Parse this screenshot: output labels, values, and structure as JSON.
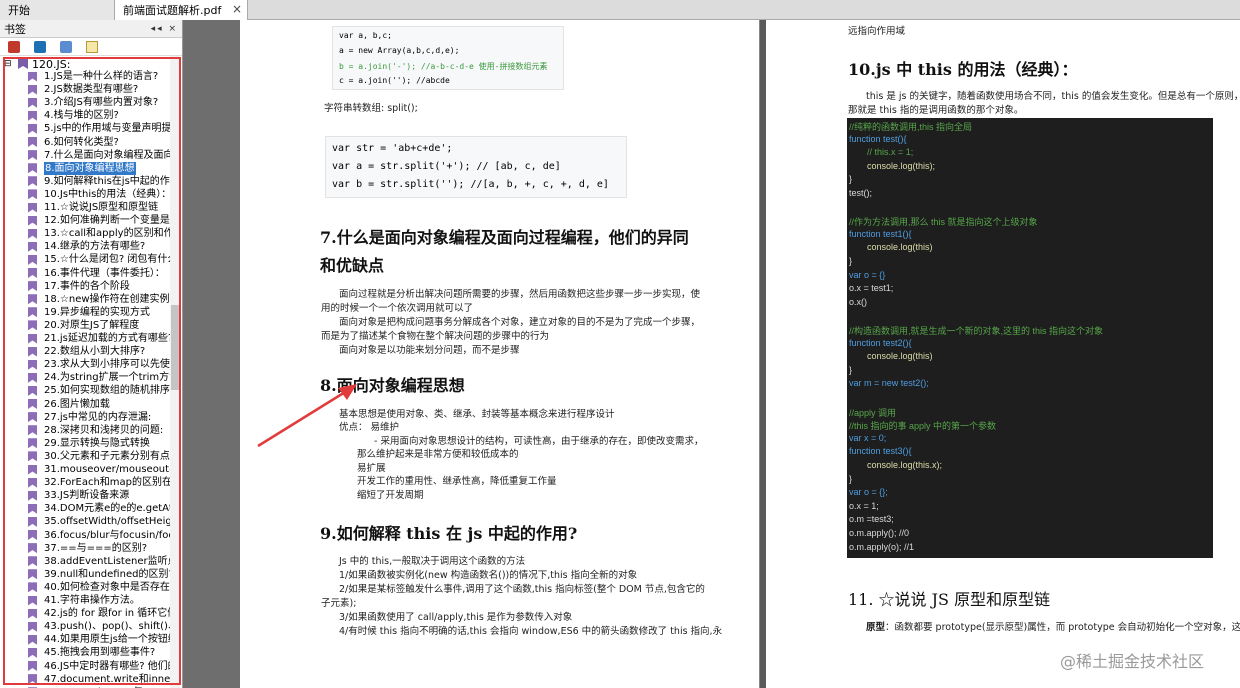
{
  "tabs": [
    {
      "label": "开始"
    },
    {
      "label": "前端面试题解析.pdf",
      "close": "×"
    }
  ],
  "sidebar": {
    "title": "书签",
    "controls": "◂◂ ×",
    "root_label": "120.JS:",
    "root_toggle": "⊟",
    "items": [
      "1.JS是一种什么样的语言?",
      "2.JS数据类型有哪些?",
      "3.介绍JS有哪些内置对象?",
      "4.栈与堆的区别?",
      "5.js中的作用域与变量声明提升",
      "6.如何转化类型?",
      "7.什么是面向对象编程及面向过程",
      "8.面向对象编程思想",
      "9.如何解释this在js中起的作用?",
      "10.Js中this的用法（经典）：",
      "11.☆说说JS原型和原型链",
      "12.如何准确判断一个变量是数组",
      "13.☆call和apply的区别和作用?",
      "14.继承的方法有哪些?",
      "15.☆什么是闭包? 闭包有什么作用",
      "16.事件代理（事件委托）：",
      "17.事件的各个阶段",
      "18.☆new操作符在创建实例的时候",
      "19.异步编程的实现方式",
      "20.对原生JS了解程度",
      "21.js延迟加载的方式有哪些?",
      "22.数组从小到大排序?",
      "23.求从大到小排序可以先使数组",
      "24.为string扩展一个trim方法,取",
      "25.如何实现数组的随机排序?",
      "26.图片懒加载",
      "27.js中常见的内存泄漏:",
      "28.深拷贝和浅拷贝的问题:",
      "29.显示转换与隐式转换",
      "30.父元素和子元素分别有点击事",
      "31.mouseover/mouseout与mou",
      "32.ForEach和map的区别在哪里:",
      "33.JS判断设备来源",
      "34.DOM元素e的e的e.getAttribut",
      "35.offsetWidth/offsetHeight、c",
      "36.focus/blur与focusin/focusout",
      "37.==与===的区别?",
      "38.addEventListener监听点击事",
      "39.null和undefined的区别?",
      "40.如何检查对象中是否存在某个",
      "41.字符串操作方法。",
      "42.js的 for 跟for in 循环它们之间",
      "43.push()、pop()、shift()、uns",
      "44.如果用原生js给一个按钮绑定",
      "45.拖拽会用到哪些事件?",
      "46.JS中定时器有哪些? 他们的区",
      "47.document.write和innerHTMl",
      "48.createElement与createDocu"
    ],
    "selected_index": 7
  },
  "page1": {
    "code1": [
      "var a, b,c;",
      "a = new Array(a,b,c,d,e);",
      "b = a.join('-'); //a-b-c-d-e  使用-拼接数组元素",
      "c = a.join(''); //abcde"
    ],
    "split_label": "字符串转数组: split();",
    "code2": [
      "var str = 'ab+c+de';",
      "var a = str.split('+'); // [ab, c, de]",
      "var b = str.split(''); //[a, b, +, c, +, d, e]"
    ],
    "h7_line1": "7.什么是面向对象编程及面向过程编程，他们的异同",
    "h7_line2": "和优缺点",
    "p7": [
      "面向过程就是分析出解决问题所需要的步骤，然后用函数把这些步骤一步一步实现，使",
      "用的时候一个一个依次调用就可以了",
      "面向对象是把构成问题事务分解成各个对象，建立对象的目的不是为了完成一个步骤，",
      "而是为了描述某个食物在整个解决问题的步骤中的行为",
      "面向对象是以功能来划分问题，而不是步骤"
    ],
    "h8": "8.面向对象编程思想",
    "p8": [
      "基本思想是使用对象、类、继承、封装等基本概念来进行程序设计",
      "优点： 易维护",
      "- 采用面向对象思想设计的结构，可读性高，由于继承的存在，即使改变需求，",
      "那么维护起来是非常方便和较低成本的",
      "易扩展",
      "开发工作的重用性、继承性高，降低重复工作量",
      "缩短了开发周期"
    ],
    "h9": "9.如何解释 this 在 js 中起的作用?",
    "p9": [
      "Js 中的 this,一般取决于调用这个函数的方法",
      "1/如果函数被实例化(new  构造函数名())的情况下,this 指向全新的对象",
      "2/如果是某标签触发什么事件,调用了这个函数,this 指向标签(整个 DOM 节点,包含它的",
      "子元素);",
      "3/如果函数使用了 call/apply,this 是作为参数传入对象",
      "4/有时候 this 指向不明确的话,this 会指向 window,ES6 中的箭头函数修改了 this 指向,永"
    ]
  },
  "page2": {
    "top_text": "远指向作用域",
    "h10": "10.js 中 this 的用法（经典）：",
    "p10": [
      "this 是 js 的关键字，随着函数使用场合不同，this 的值会发生变化。但是总有一个原则，",
      "那就是 this 指的是调用函数的那个对象。"
    ],
    "code": [
      "//纯粹的函数调用,this 指向全局",
      "function test(){",
      "    // this.x = 1;",
      "    console.log(this);",
      "}",
      "test();",
      "",
      "//作为方法调用,那么 this 就是指向这个上级对象",
      "function test1(){",
      "    console.log(this)",
      "}",
      "var o = {}",
      "o.x = test1;",
      "o.x()",
      "",
      "//构造函数调用,就是生成一个新的对象,这里的 this 指向这个对象",
      "function test2(){",
      "    console.log(this)",
      "}",
      "var m = new test2();",
      "",
      "//apply 调用",
      "//this 指向的事 apply 中的第一个参数",
      "var x = 0;",
      "function test3(){",
      "    console.log(this.x);",
      "}",
      "var o = {};",
      "o.x = 1;",
      "o.m =test3;",
      "o.m.apply(); //0",
      "o.m.apply(o); //1"
    ],
    "h11": "11. ☆说说 JS 原型和原型链",
    "p11_bold": "原型",
    "p11": "：函数都要 prototype(显示原型)属性，而 prototype 会自动初始化一个空对象，这"
  },
  "watermark": "@稀土掘金技术社区",
  "colors": {
    "highlight_box": "#e23b3b",
    "arrow": "#e23b3b",
    "selection": "#3379c9"
  }
}
